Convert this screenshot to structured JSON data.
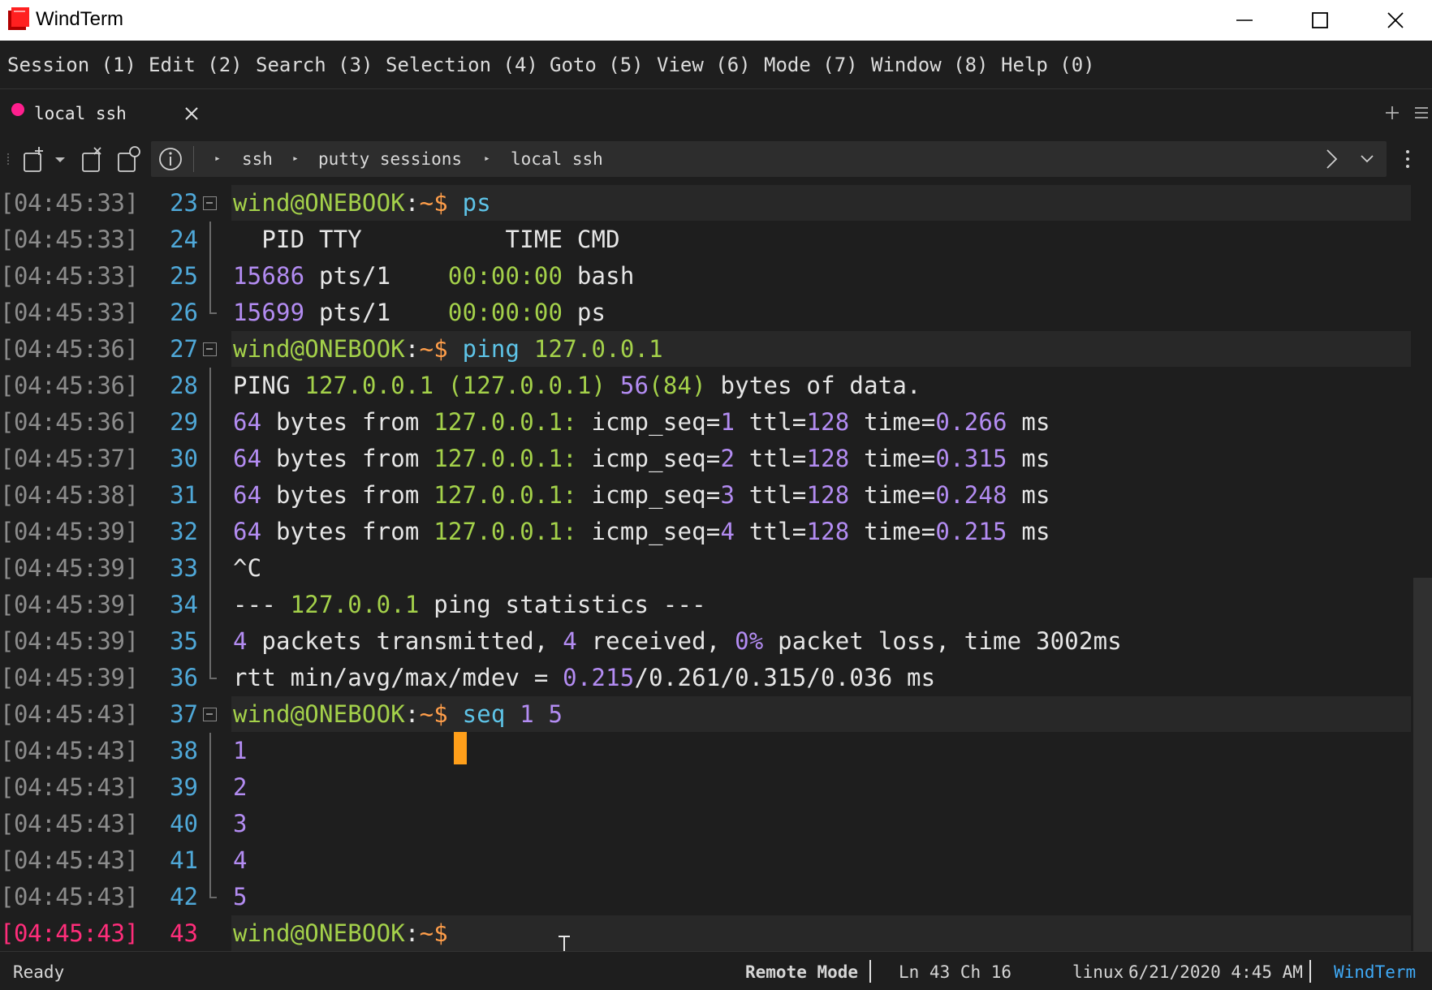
{
  "window": {
    "title": "WindTerm"
  },
  "menu": [
    "Session (1)",
    "Edit (2)",
    "Search (3)",
    "Selection (4)",
    "Goto (5)",
    "View (6)",
    "Mode (7)",
    "Window (8)",
    "Help (0)"
  ],
  "tab": {
    "label": "local ssh",
    "dot_color": "#ff1f8e"
  },
  "breadcrumb": [
    "ssh",
    "putty sessions",
    "local ssh"
  ],
  "terminal": {
    "lines": [
      {
        "ts": "[04:45:33]",
        "ln": "23",
        "type": "cmd",
        "segs": [
          [
            "wind@ONEBOOK",
            "g"
          ],
          [
            ":",
            "w"
          ],
          [
            "~$ ",
            "o"
          ],
          [
            "ps",
            "b"
          ]
        ]
      },
      {
        "ts": "[04:45:33]",
        "ln": "24",
        "type": "mid",
        "segs": [
          [
            "  PID TTY          TIME CMD",
            "w"
          ]
        ]
      },
      {
        "ts": "[04:45:33]",
        "ln": "25",
        "type": "mid",
        "segs": [
          [
            "15686",
            "p"
          ],
          [
            " pts/1    ",
            "w"
          ],
          [
            "00:00:00",
            "g"
          ],
          [
            " bash",
            "w"
          ]
        ]
      },
      {
        "ts": "[04:45:33]",
        "ln": "26",
        "type": "end",
        "segs": [
          [
            "15699",
            "p"
          ],
          [
            " pts/1    ",
            "w"
          ],
          [
            "00:00:00",
            "g"
          ],
          [
            " ps",
            "w"
          ]
        ]
      },
      {
        "ts": "[04:45:36]",
        "ln": "27",
        "type": "cmd",
        "segs": [
          [
            "wind@ONEBOOK",
            "g"
          ],
          [
            ":",
            "w"
          ],
          [
            "~$ ",
            "o"
          ],
          [
            "ping ",
            "b"
          ],
          [
            "127.0.0.1",
            "g"
          ]
        ]
      },
      {
        "ts": "[04:45:36]",
        "ln": "28",
        "type": "mid",
        "segs": [
          [
            "PING ",
            "w"
          ],
          [
            "127.0.0.1 (127.0.0.1) ",
            "g"
          ],
          [
            "56",
            "p"
          ],
          [
            "(84) ",
            "g"
          ],
          [
            "bytes of data.",
            "w"
          ]
        ]
      },
      {
        "ts": "[04:45:36]",
        "ln": "29",
        "type": "mid",
        "segs": [
          [
            "64",
            "p"
          ],
          [
            " bytes from ",
            "w"
          ],
          [
            "127.0.0.1:",
            "g"
          ],
          [
            " icmp_seq=",
            "w"
          ],
          [
            "1",
            "p"
          ],
          [
            " ttl=",
            "w"
          ],
          [
            "128",
            "p"
          ],
          [
            " time=",
            "w"
          ],
          [
            "0.266",
            "p"
          ],
          [
            " ms",
            "w"
          ]
        ]
      },
      {
        "ts": "[04:45:37]",
        "ln": "30",
        "type": "mid",
        "segs": [
          [
            "64",
            "p"
          ],
          [
            " bytes from ",
            "w"
          ],
          [
            "127.0.0.1:",
            "g"
          ],
          [
            " icmp_seq=",
            "w"
          ],
          [
            "2",
            "p"
          ],
          [
            " ttl=",
            "w"
          ],
          [
            "128",
            "p"
          ],
          [
            " time=",
            "w"
          ],
          [
            "0.315",
            "p"
          ],
          [
            " ms",
            "w"
          ]
        ]
      },
      {
        "ts": "[04:45:38]",
        "ln": "31",
        "type": "mid",
        "segs": [
          [
            "64",
            "p"
          ],
          [
            " bytes from ",
            "w"
          ],
          [
            "127.0.0.1:",
            "g"
          ],
          [
            " icmp_seq=",
            "w"
          ],
          [
            "3",
            "p"
          ],
          [
            " ttl=",
            "w"
          ],
          [
            "128",
            "p"
          ],
          [
            " time=",
            "w"
          ],
          [
            "0.248",
            "p"
          ],
          [
            " ms",
            "w"
          ]
        ]
      },
      {
        "ts": "[04:45:39]",
        "ln": "32",
        "type": "mid",
        "segs": [
          [
            "64",
            "p"
          ],
          [
            " bytes from ",
            "w"
          ],
          [
            "127.0.0.1:",
            "g"
          ],
          [
            " icmp_seq=",
            "w"
          ],
          [
            "4",
            "p"
          ],
          [
            " ttl=",
            "w"
          ],
          [
            "128",
            "p"
          ],
          [
            " time=",
            "w"
          ],
          [
            "0.215",
            "p"
          ],
          [
            " ms",
            "w"
          ]
        ]
      },
      {
        "ts": "[04:45:39]",
        "ln": "33",
        "type": "mid",
        "segs": [
          [
            "^C",
            "w"
          ]
        ]
      },
      {
        "ts": "[04:45:39]",
        "ln": "34",
        "type": "mid",
        "segs": [
          [
            "--- ",
            "w"
          ],
          [
            "127.0.0.1",
            "g"
          ],
          [
            " ping statistics ---",
            "w"
          ]
        ]
      },
      {
        "ts": "[04:45:39]",
        "ln": "35",
        "type": "mid",
        "segs": [
          [
            "4",
            "p"
          ],
          [
            " packets transmitted, ",
            "w"
          ],
          [
            "4",
            "p"
          ],
          [
            " received, ",
            "w"
          ],
          [
            "0%",
            "p"
          ],
          [
            " packet loss, time 3002ms",
            "w"
          ]
        ]
      },
      {
        "ts": "[04:45:39]",
        "ln": "36",
        "type": "end",
        "segs": [
          [
            "rtt min/avg/max/mdev = ",
            "w"
          ],
          [
            "0.215",
            "p"
          ],
          [
            "/0.261/0.315/0.036 ms",
            "w"
          ]
        ]
      },
      {
        "ts": "[04:45:43]",
        "ln": "37",
        "type": "cmd",
        "segs": [
          [
            "wind@ONEBOOK",
            "g"
          ],
          [
            ":",
            "w"
          ],
          [
            "~$ ",
            "o"
          ],
          [
            "seq ",
            "b"
          ],
          [
            "1 5",
            "p"
          ]
        ]
      },
      {
        "ts": "[04:45:43]",
        "ln": "38",
        "type": "mid",
        "segs": [
          [
            "1",
            "p"
          ]
        ]
      },
      {
        "ts": "[04:45:43]",
        "ln": "39",
        "type": "mid",
        "segs": [
          [
            "2",
            "p"
          ]
        ]
      },
      {
        "ts": "[04:45:43]",
        "ln": "40",
        "type": "mid",
        "segs": [
          [
            "3",
            "p"
          ]
        ]
      },
      {
        "ts": "[04:45:43]",
        "ln": "41",
        "type": "mid",
        "segs": [
          [
            "4",
            "p"
          ]
        ]
      },
      {
        "ts": "[04:45:43]",
        "ln": "42",
        "type": "end",
        "segs": [
          [
            "5",
            "p"
          ]
        ]
      },
      {
        "ts": "[04:45:43]",
        "ln": "43",
        "type": "current",
        "segs": [
          [
            "wind@ONEBOOK",
            "g"
          ],
          [
            ":",
            "w"
          ],
          [
            "~$ ",
            "o"
          ]
        ]
      }
    ]
  },
  "status": {
    "left": "Ready",
    "mode": "Remote Mode",
    "position": "Ln 43 Ch 16",
    "os": "linux",
    "datetime": "6/21/2020 4:45 AM",
    "brand": "WindTerm"
  },
  "colors": {
    "accent": "#3fa9f5",
    "cursor": "#ff9f1a",
    "prompt": "#a4d14a",
    "current_line": "#ff2d7a"
  }
}
